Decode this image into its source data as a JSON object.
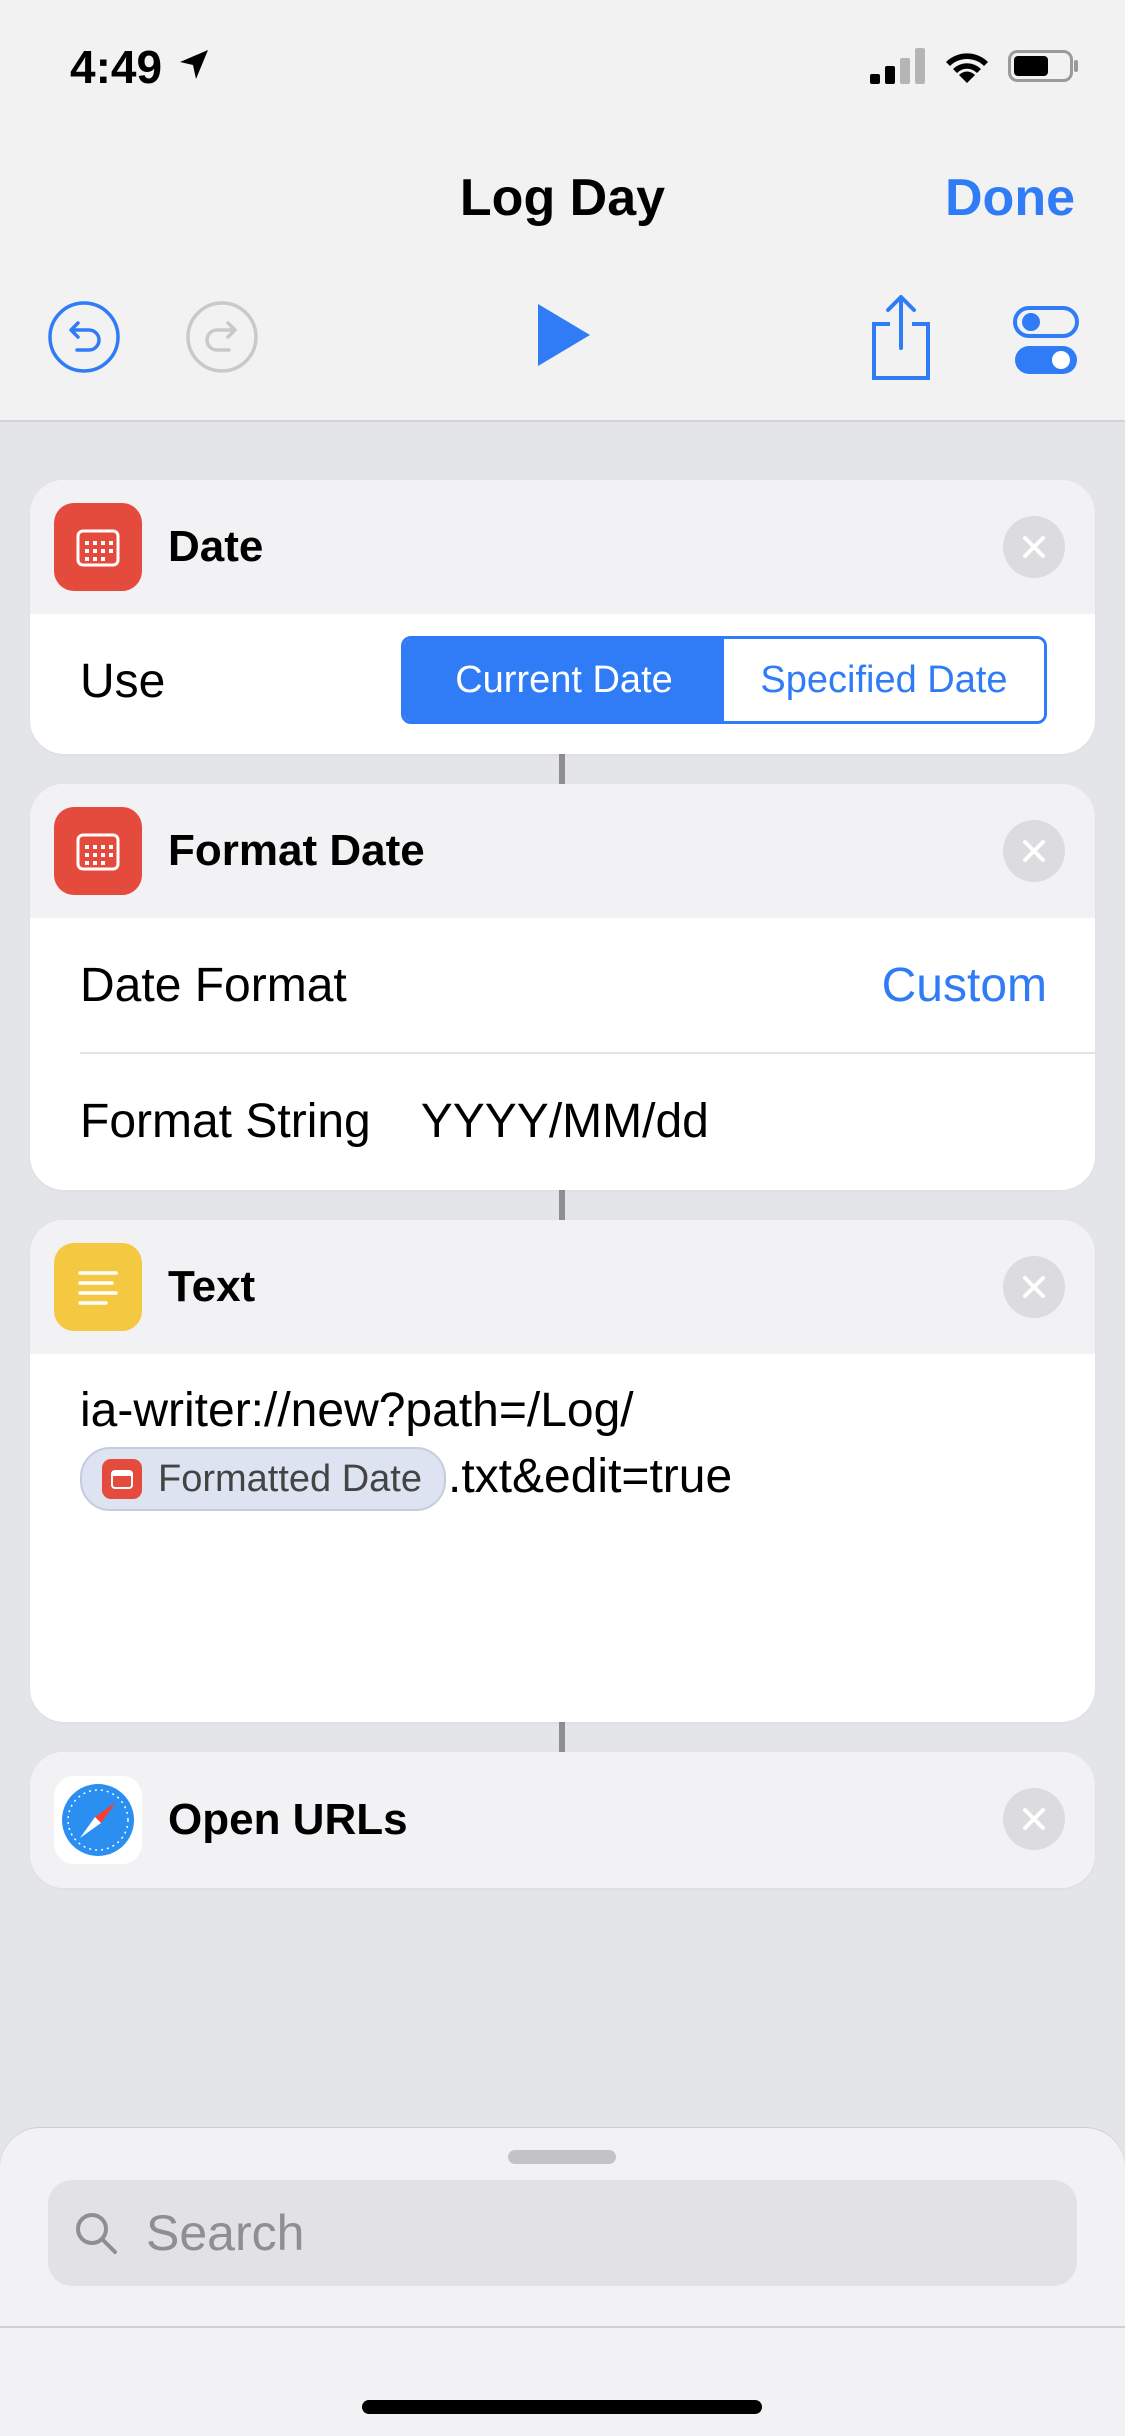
{
  "status_bar": {
    "time": "4:49"
  },
  "nav": {
    "title": "Log Day",
    "done_label": "Done"
  },
  "toolbar": {
    "undo_icon": "undo-icon",
    "redo_icon": "redo-icon",
    "play_icon": "play-icon",
    "share_icon": "share-icon",
    "settings_icon": "toggles-icon"
  },
  "actions": {
    "date": {
      "title": "Date",
      "use_label": "Use",
      "options": [
        "Current Date",
        "Specified Date"
      ],
      "selected": "Current Date"
    },
    "format_date": {
      "title": "Format Date",
      "date_format_label": "Date Format",
      "date_format_value": "Custom",
      "format_string_label": "Format String",
      "format_string_value": "YYYY/MM/dd"
    },
    "text": {
      "title": "Text",
      "line1": "ia-writer://new?path=/Log/",
      "variable": "Formatted Date",
      "line2_suffix": ".txt&edit=true"
    },
    "open_urls": {
      "title": "Open URLs"
    }
  },
  "search": {
    "placeholder": "Search"
  },
  "colors": {
    "accent": "#2f7cf6",
    "calendar_red": "#e54b3c",
    "text_yellow": "#f5c842",
    "background": "#e4e5e8"
  }
}
